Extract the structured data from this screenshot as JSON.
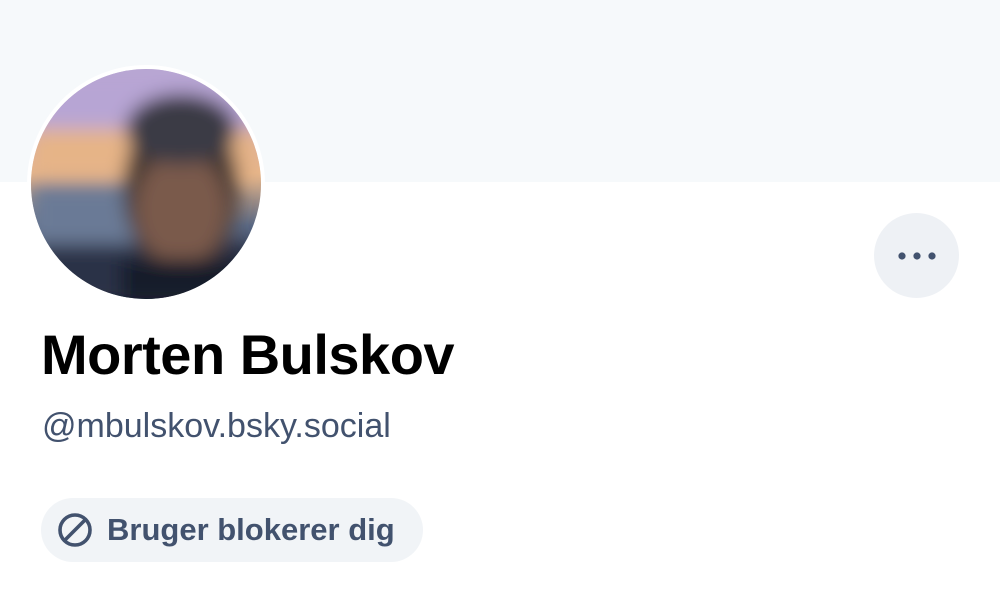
{
  "profile": {
    "display_name": "Morten Bulskov",
    "handle": "@mbulskov.bsky.social",
    "blocked_label": "Bruger blokerer dig",
    "avatar_icon": "user-avatar",
    "more_icon": "ellipsis-icon",
    "blocked_icon": "block-icon"
  },
  "colors": {
    "banner": "#f6f9fb",
    "text_primary": "#000000",
    "text_secondary": "#42526e",
    "button_bg": "#eef1f5",
    "badge_bg": "#f1f4f7"
  }
}
